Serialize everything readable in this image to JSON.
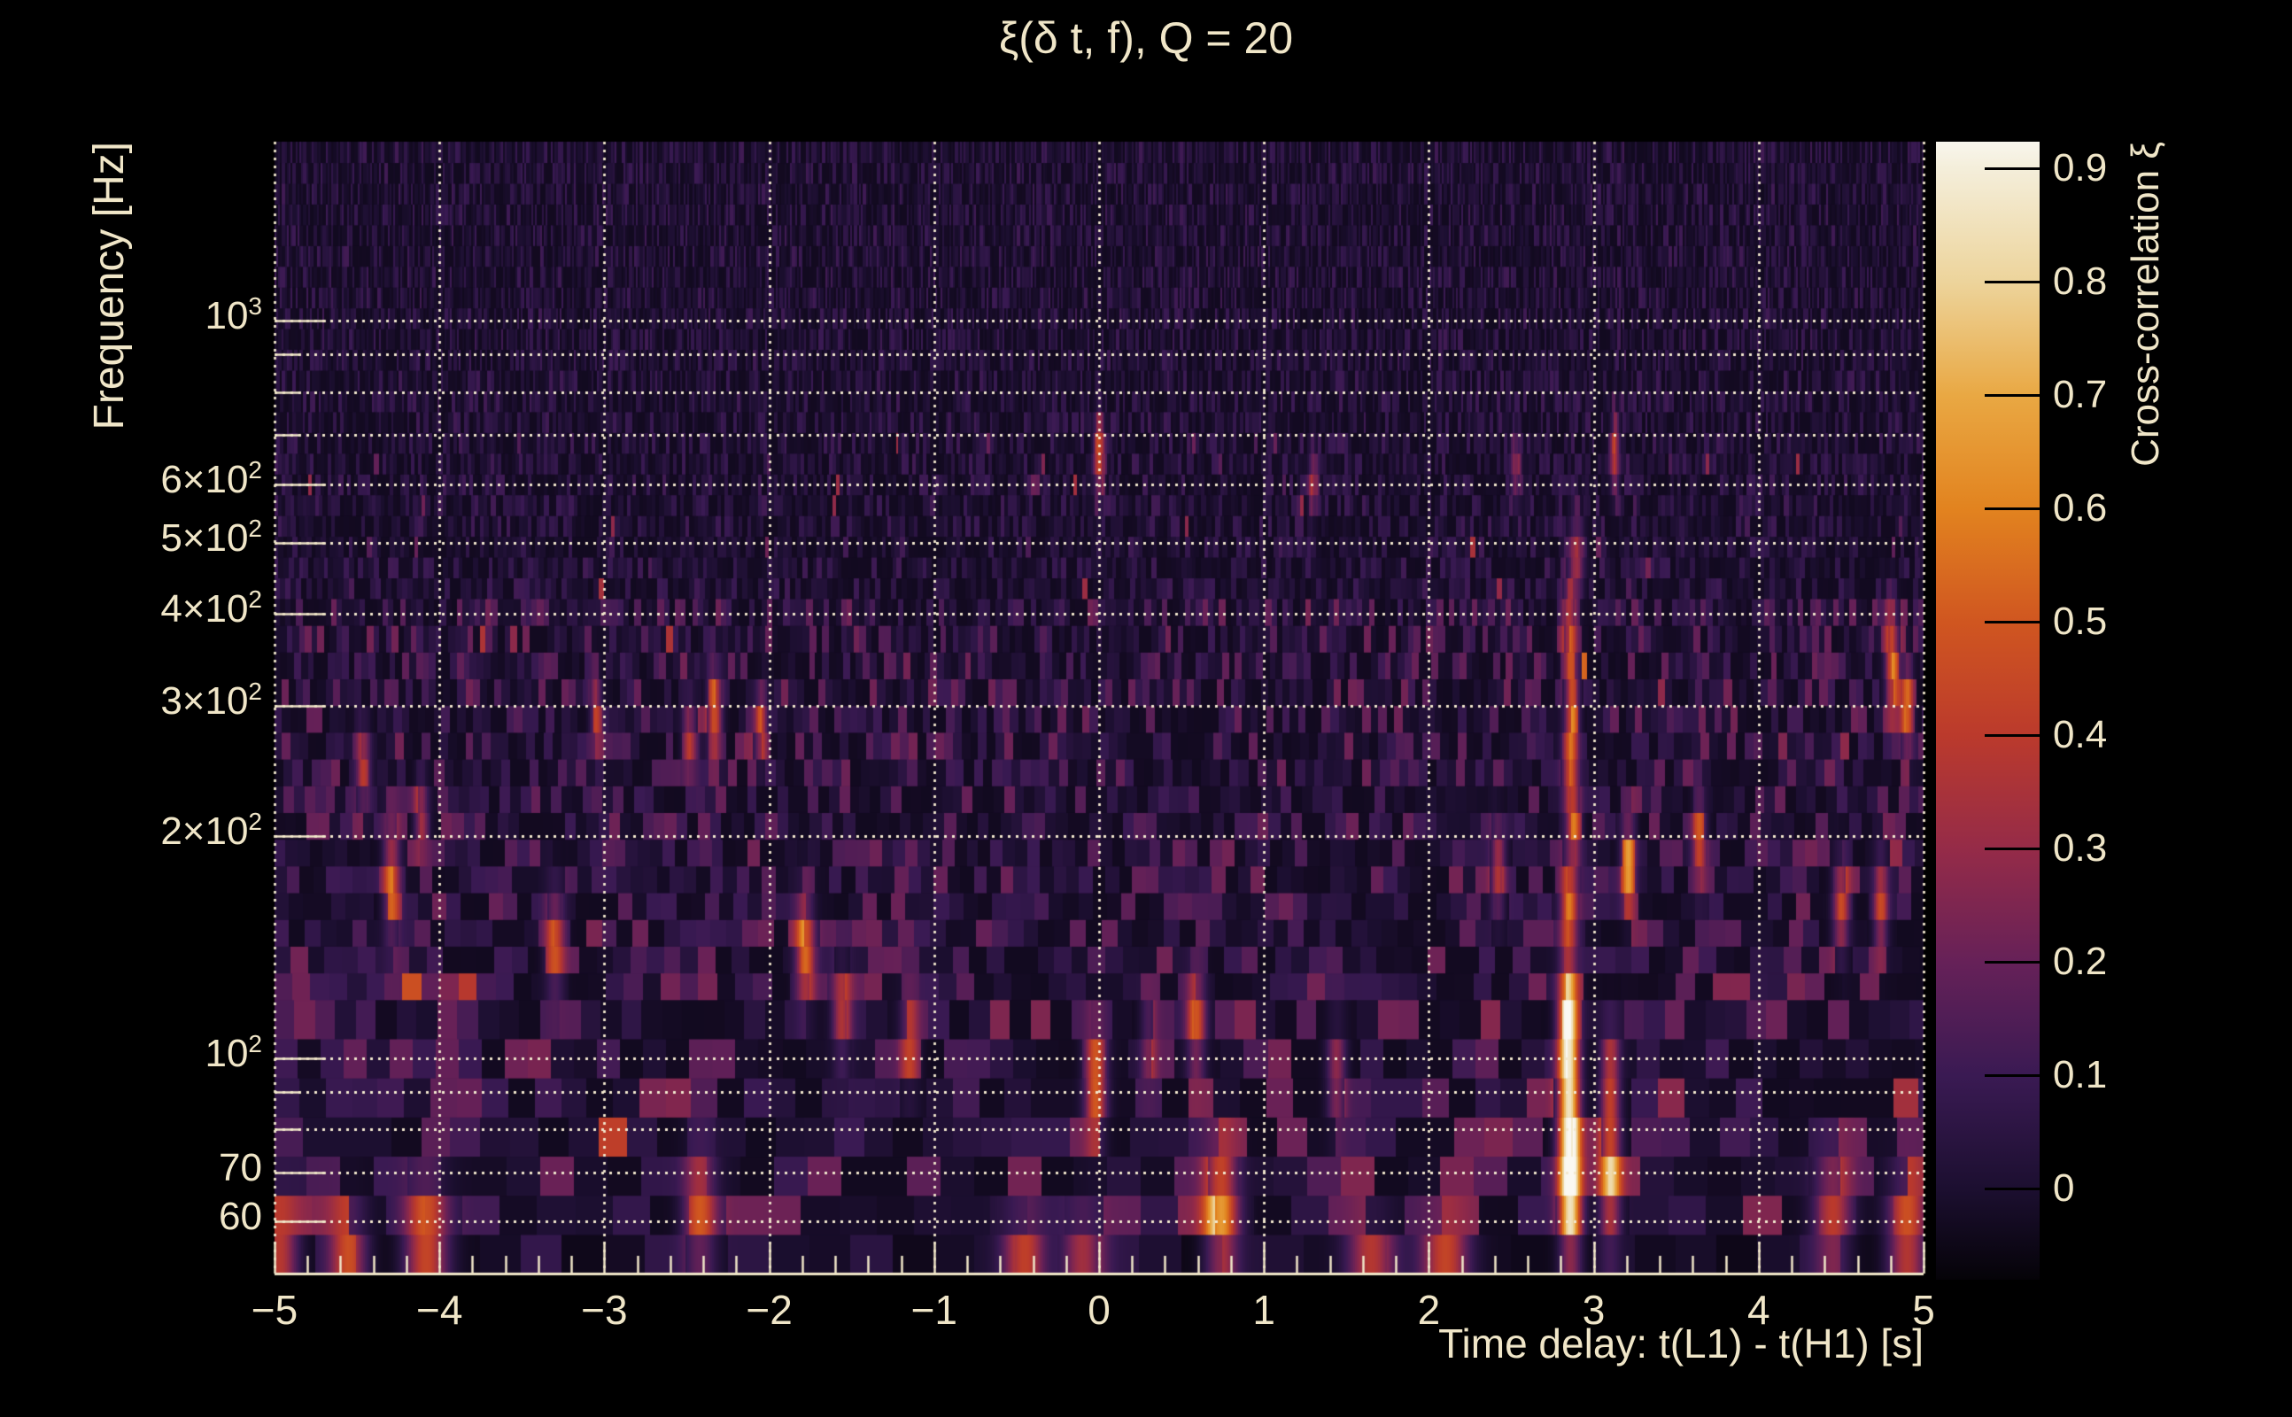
{
  "title": "ξ(δ t, f), Q = 20",
  "colors": {
    "background": "#000000",
    "text": "#f0e6c8",
    "axis": "#f0e6c8",
    "gridline": "#f2e8ce",
    "colorbar_tick": "#000000"
  },
  "chart_data": {
    "type": "heatmap",
    "title": "ξ(δ t, f), Q = 20",
    "xlabel": "Time delay: t(L1) - t(H1) [s]",
    "ylabel": "Frequency [Hz]",
    "colorbar_label": "Cross-correlation ξ",
    "x_range": [
      -5,
      5
    ],
    "x_scale": "linear",
    "y_range_hz": [
      51,
      1750
    ],
    "y_scale": "log",
    "z_range": [
      -0.08,
      0.924
    ],
    "grid": true,
    "x_ticks": [
      {
        "t": -5,
        "label": "−5"
      },
      {
        "t": -4,
        "label": "−4"
      },
      {
        "t": -3,
        "label": "−3"
      },
      {
        "t": -2,
        "label": "−2"
      },
      {
        "t": -1,
        "label": "−1"
      },
      {
        "t": 0,
        "label": "0"
      },
      {
        "t": 1,
        "label": "1"
      },
      {
        "t": 2,
        "label": "2"
      },
      {
        "t": 3,
        "label": "3"
      },
      {
        "t": 4,
        "label": "4"
      },
      {
        "t": 5,
        "label": "5"
      }
    ],
    "x_minor_step": 0.2,
    "y_ticks": [
      {
        "f": 1000,
        "base": "10",
        "exp": "3"
      },
      {
        "f": 600,
        "base": "6×10",
        "exp": "2"
      },
      {
        "f": 500,
        "base": "5×10",
        "exp": "2"
      },
      {
        "f": 400,
        "base": "4×10",
        "exp": "2"
      },
      {
        "f": 300,
        "base": "3×10",
        "exp": "2"
      },
      {
        "f": 200,
        "base": "2×10",
        "exp": "2"
      },
      {
        "f": 100,
        "base": "10",
        "exp": "2"
      },
      {
        "f": 70,
        "base": "70"
      },
      {
        "f": 60,
        "base": "60"
      }
    ],
    "y_gridlines_hz": [
      60,
      70,
      80,
      90,
      100,
      200,
      300,
      400,
      500,
      600,
      700,
      800,
      900,
      1000
    ],
    "colorbar_ticks": [
      {
        "v": 0.9,
        "label": "0.9"
      },
      {
        "v": 0.8,
        "label": "0.8"
      },
      {
        "v": 0.7,
        "label": "0.7"
      },
      {
        "v": 0.6,
        "label": "0.6"
      },
      {
        "v": 0.5,
        "label": "0.5"
      },
      {
        "v": 0.4,
        "label": "0.4"
      },
      {
        "v": 0.3,
        "label": "0.3"
      },
      {
        "v": 0.2,
        "label": "0.2"
      },
      {
        "v": 0.1,
        "label": "0.1"
      },
      {
        "v": 0.0,
        "label": "0"
      }
    ],
    "colormap_stops": [
      [
        -0.08,
        "#050308"
      ],
      [
        0.0,
        "#1c0f30"
      ],
      [
        0.1,
        "#3a1a53"
      ],
      [
        0.2,
        "#662158"
      ],
      [
        0.3,
        "#952b48"
      ],
      [
        0.4,
        "#bb3a2c"
      ],
      [
        0.5,
        "#d05620"
      ],
      [
        0.6,
        "#e2831f"
      ],
      [
        0.7,
        "#e9a843"
      ],
      [
        0.8,
        "#edd49b"
      ],
      [
        0.9,
        "#f4eeda"
      ],
      [
        0.93,
        "#faf8f2"
      ]
    ],
    "noise": {
      "seed": 1234,
      "base": -0.032,
      "amp_default": 0.26,
      "amp_high_f": 0.15,
      "amp_band_60_130": 0.3,
      "amp_bottom_band": 0.13,
      "high_f_split_hz": 420,
      "bottom_band_hz": 57,
      "dash_prob": 0.016,
      "rows_per_decade": [
        [
          51,
          120,
          20
        ],
        [
          120,
          420,
          28
        ],
        [
          420,
          1750,
          36
        ]
      ],
      "bin_width_s_rule": {
        "coef": 14,
        "min_s": 0.013,
        "max_s": 0.25
      }
    },
    "hotspots": [
      [
        2.85,
        76,
        0.93,
        0.045,
        0.055
      ],
      [
        2.85,
        98,
        0.72,
        0.045,
        0.045
      ],
      [
        2.86,
        61,
        0.68,
        0.05,
        0.04
      ],
      [
        3.1,
        70,
        0.58,
        0.045,
        0.06
      ],
      [
        3.1,
        95,
        0.42,
        0.04,
        0.04
      ],
      [
        2.84,
        118,
        0.62,
        0.04,
        0.04
      ],
      [
        2.85,
        160,
        0.52,
        0.035,
        0.04
      ],
      [
        2.88,
        210,
        0.45,
        0.03,
        0.035
      ],
      [
        2.85,
        250,
        0.4,
        0.03,
        0.035
      ],
      [
        2.87,
        300,
        0.45,
        0.03,
        0.04
      ],
      [
        2.85,
        390,
        0.4,
        0.03,
        0.04
      ],
      [
        2.9,
        480,
        0.33,
        0.03,
        0.035
      ],
      [
        -0.02,
        93,
        0.6,
        0.045,
        0.045
      ],
      [
        0.0,
        660,
        0.5,
        0.022,
        0.035
      ],
      [
        0.59,
        112,
        0.5,
        0.04,
        0.04
      ],
      [
        -2.33,
        297,
        0.52,
        0.03,
        0.035
      ],
      [
        -2.48,
        273,
        0.34,
        0.03,
        0.03
      ],
      [
        -2.05,
        285,
        0.4,
        0.025,
        0.03
      ],
      [
        -4.08,
        57,
        0.55,
        0.09,
        0.045
      ],
      [
        -4.55,
        54,
        0.42,
        0.08,
        0.04
      ],
      [
        -4.97,
        53,
        0.45,
        0.08,
        0.04
      ],
      [
        -4.29,
        175,
        0.42,
        0.035,
        0.05
      ],
      [
        -4.46,
        250,
        0.34,
        0.03,
        0.035
      ],
      [
        -4.11,
        215,
        0.36,
        0.03,
        0.03
      ],
      [
        -1.78,
        140,
        0.52,
        0.04,
        0.045
      ],
      [
        -1.56,
        115,
        0.4,
        0.04,
        0.04
      ],
      [
        -2.42,
        62,
        0.42,
        0.07,
        0.05
      ],
      [
        -0.45,
        52,
        0.5,
        0.09,
        0.04
      ],
      [
        -0.1,
        52,
        0.42,
        0.09,
        0.04
      ],
      [
        0.75,
        62,
        0.36,
        0.07,
        0.05
      ],
      [
        0.73,
        63,
        0.32,
        0.07,
        0.05
      ],
      [
        1.65,
        51,
        0.5,
        0.1,
        0.04
      ],
      [
        2.1,
        51,
        0.58,
        0.1,
        0.04
      ],
      [
        1.44,
        95,
        0.36,
        0.04,
        0.04
      ],
      [
        2.42,
        180,
        0.4,
        0.03,
        0.04
      ],
      [
        3.21,
        183,
        0.5,
        0.03,
        0.04
      ],
      [
        3.64,
        197,
        0.4,
        0.03,
        0.035
      ],
      [
        4.5,
        160,
        0.45,
        0.035,
        0.04
      ],
      [
        4.74,
        162,
        0.45,
        0.03,
        0.04
      ],
      [
        4.81,
        345,
        0.5,
        0.03,
        0.045
      ],
      [
        4.9,
        300,
        0.42,
        0.025,
        0.04
      ],
      [
        4.45,
        62,
        0.4,
        0.08,
        0.05
      ],
      [
        4.9,
        58,
        0.5,
        0.08,
        0.05
      ],
      [
        3.13,
        660,
        0.38,
        0.02,
        0.035
      ],
      [
        2.53,
        640,
        0.28,
        0.02,
        0.03
      ],
      [
        1.3,
        610,
        0.3,
        0.02,
        0.03
      ],
      [
        -3.3,
        145,
        0.38,
        0.04,
        0.045
      ],
      [
        -3.05,
        300,
        0.33,
        0.025,
        0.03
      ],
      [
        -1.15,
        105,
        0.3,
        0.04,
        0.04
      ],
      [
        0.3,
        105,
        0.25,
        0.035,
        0.035
      ]
    ]
  }
}
